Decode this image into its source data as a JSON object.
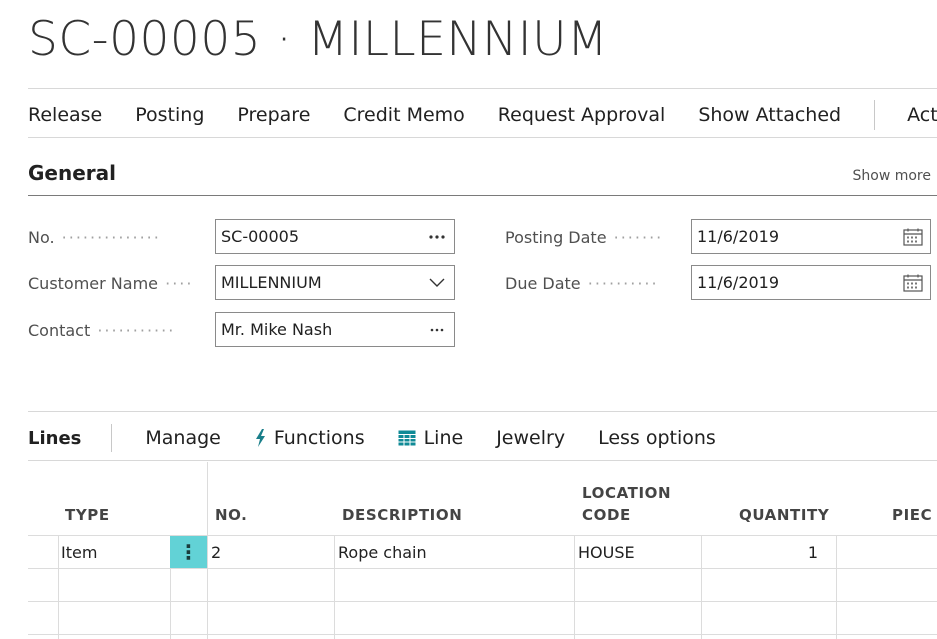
{
  "page": {
    "title": "SC-00005 · MILLENNIUM"
  },
  "actions": {
    "release": "Release",
    "posting": "Posting",
    "prepare": "Prepare",
    "credit_memo": "Credit Memo",
    "request_approval": "Request Approval",
    "show_attached": "Show Attached",
    "more": "Actions"
  },
  "general": {
    "title": "General",
    "show_more": "Show more",
    "fields": {
      "no": {
        "label": "No.",
        "value": "SC-00005"
      },
      "customer_name": {
        "label": "Customer Name",
        "value": "MILLENNIUM"
      },
      "contact": {
        "label": "Contact",
        "value": "Mr. Mike Nash"
      },
      "posting_date": {
        "label": "Posting Date",
        "value": "11/6/2019"
      },
      "due_date": {
        "label": "Due Date",
        "value": "11/6/2019"
      }
    }
  },
  "lines": {
    "title": "Lines",
    "actions": {
      "manage": "Manage",
      "functions": "Functions",
      "line": "Line",
      "jewelry": "Jewelry",
      "less_options": "Less options"
    },
    "columns": {
      "type": "TYPE",
      "no": "NO.",
      "description": "DESCRIPTION",
      "location_code_1": "LOCATION",
      "location_code_2": "CODE",
      "quantity": "QUANTITY",
      "pieces": "PIEC"
    },
    "rows": [
      {
        "type": "Item",
        "no": "2",
        "description": "Rope chain",
        "location_code": "HOUSE",
        "quantity": "1"
      }
    ]
  },
  "icons": {
    "lookup": "ellipsis-icon",
    "dropdown": "chevron-down-icon",
    "calendar": "calendar-icon",
    "functions": "lightning-icon",
    "line": "grid-icon",
    "row_menu": "vertical-ellipsis-icon"
  },
  "colors": {
    "accent": "#62d2d6",
    "functions_icon": "#1a7f8a",
    "grid_icon": "#0f8a96"
  }
}
